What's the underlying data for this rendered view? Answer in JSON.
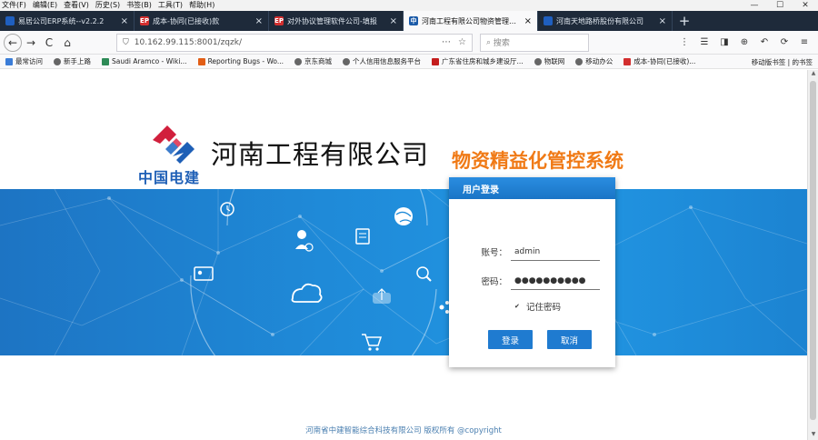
{
  "menu": [
    "文件(F)",
    "编辑(E)",
    "查看(V)",
    "历史(S)",
    "书签(B)",
    "工具(T)",
    "帮助(H)"
  ],
  "window_controls": {
    "min": "—",
    "max": "☐",
    "close": "✕"
  },
  "tabs": [
    {
      "title": "易居公司ERP系统--v2.2.2",
      "fav": "",
      "fav_style": "blue",
      "close": "×"
    },
    {
      "title": "成本-协同(已接收)款",
      "fav": "EP",
      "fav_style": "ep",
      "close": "×"
    },
    {
      "title": "对外协议管理软件公司-填报",
      "fav": "EP",
      "fav_style": "ep",
      "close": "×"
    },
    {
      "title": "河南工程有限公司物资管理系统",
      "fav": "中",
      "fav_style": "cn",
      "close": "×"
    },
    {
      "title": "河南天地路桥股份有限公司",
      "fav": "",
      "fav_style": "blue",
      "close": "×"
    }
  ],
  "new_tab": "+",
  "nav": {
    "back": "←",
    "forward": "→",
    "reload": "C",
    "home": "⌂",
    "url": "10.162.99.115:8001/zqzk/",
    "search_placeholder": "搜索",
    "tools": [
      "⋮",
      "☰",
      "◨",
      "⊕",
      "↶",
      "⟳",
      "≡"
    ]
  },
  "bookmarks": [
    {
      "label": "最常访问",
      "color": "#3b7dd8"
    },
    {
      "label": "新手上路",
      "color": "#444"
    },
    {
      "label": "Saudi Aramco - Wiki...",
      "color": "#2e8b57"
    },
    {
      "label": "Reporting Bugs - Wo...",
      "color": "#e25e16"
    },
    {
      "label": "京东商城",
      "color": "#444"
    },
    {
      "label": "个人信用信息服务平台",
      "color": "#444"
    },
    {
      "label": "广东省住房和城乡建设厅...",
      "color": "#c41d1d"
    },
    {
      "label": "物联网",
      "color": "#444"
    },
    {
      "label": "移动办公",
      "color": "#444"
    },
    {
      "label": "成本-协同(已接收)...",
      "color": "#d32f2f"
    }
  ],
  "bookmarks_right": "移动版书签 | 的书签",
  "page": {
    "logo_text": "中国电建",
    "company_name": "河南工程有限公司",
    "system_name": "物资精益化管控系统",
    "footer": "河南省中建智能综合科技有限公司 版权所有 @copyright"
  },
  "login": {
    "title": "用户登录",
    "account_label": "账号：",
    "account_value": "admin",
    "password_label": "密码：",
    "password_value": "●●●●●●●●●●",
    "remember_label": "记住密码",
    "login_button": "登录",
    "cancel_button": "取消"
  },
  "colors": {
    "brand_blue": "#1e5fb6",
    "system_orange": "#f07a16",
    "banner_blue": "#1f8ad8"
  }
}
